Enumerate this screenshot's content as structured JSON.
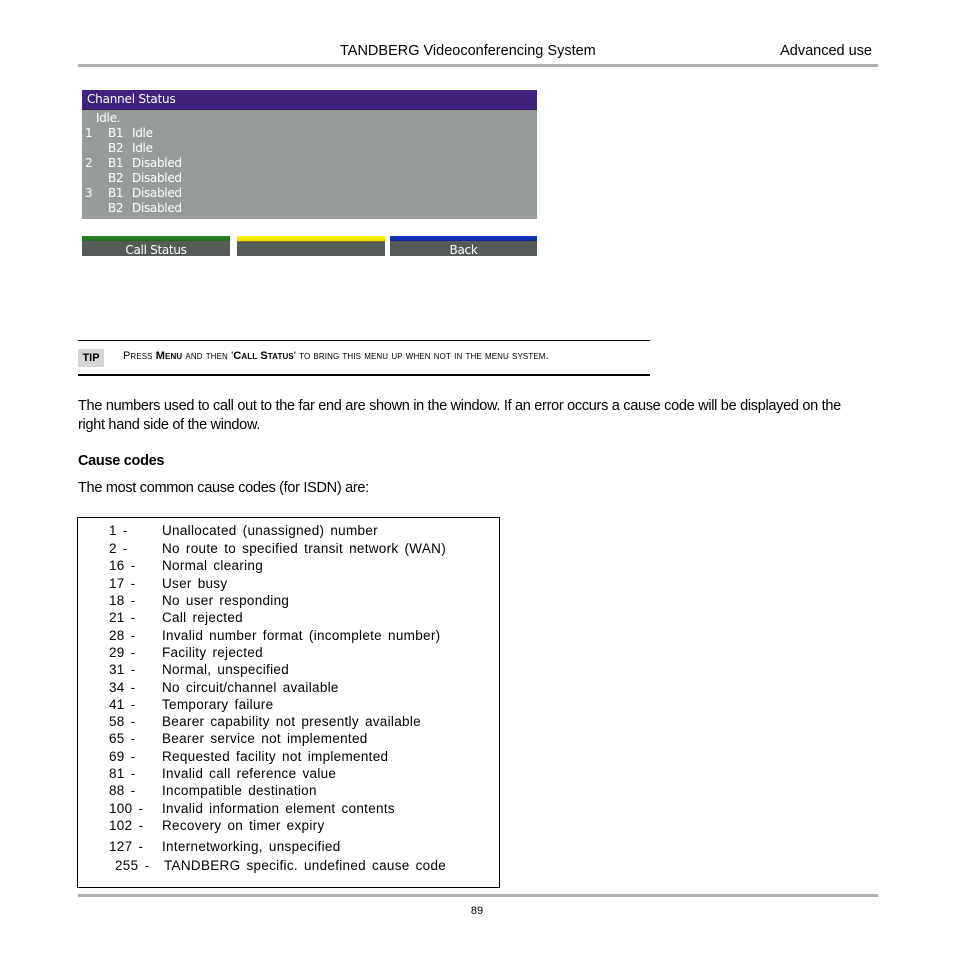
{
  "header": {
    "title": "TANDBERG Videoconferencing System",
    "section": "Advanced use"
  },
  "screen": {
    "title": "Channel Status",
    "status": "Idle.",
    "rows": [
      {
        "port": "1",
        "channel": "B1",
        "state": "Idle"
      },
      {
        "port": "",
        "channel": "B2",
        "state": "Idle"
      },
      {
        "port": "2",
        "channel": "B1",
        "state": "Disabled"
      },
      {
        "port": "",
        "channel": "B2",
        "state": "Disabled"
      },
      {
        "port": "3",
        "channel": "B1",
        "state": "Disabled"
      },
      {
        "port": "",
        "channel": "B2",
        "state": "Disabled"
      }
    ],
    "softkeys": [
      {
        "label": "Call Status",
        "color": "#2a8a2a"
      },
      {
        "label": "",
        "color": "#ffff10"
      },
      {
        "label": "Back",
        "color": "#1b3bd8"
      }
    ],
    "colors": {
      "title_bg": "#40217e",
      "body_bg": "#979c99",
      "button_bg": "#565b58"
    }
  },
  "tip": {
    "badge": "TIP",
    "press": "Press ",
    "menu": "Menu",
    "and_then": " and then '",
    "call_status": "Call Status",
    "rest": "' to bring this menu up when not in the menu system."
  },
  "body": {
    "paragraph": "The numbers used to call out to the far end are shown in the window. If an error occurs a cause code will be displayed on the right hand side of the window.",
    "heading": "Cause codes",
    "intro": "The most common cause codes (for ISDN) are:"
  },
  "cause_codes": [
    {
      "code": "1 -",
      "description": "Unallocated (unassigned) number"
    },
    {
      "code": "2 -",
      "description": "No route to specified transit network (WAN)"
    },
    {
      "code": "16 -",
      "description": "Normal clearing"
    },
    {
      "code": "17 -",
      "description": "User busy"
    },
    {
      "code": "18 -",
      "description": "No user responding"
    },
    {
      "code": "21 -",
      "description": "Call rejected"
    },
    {
      "code": "28 -",
      "description": "Invalid number format (incomplete number)"
    },
    {
      "code": "29 -",
      "description": "Facility rejected"
    },
    {
      "code": "31 -",
      "description": "Normal, unspecified"
    },
    {
      "code": "34 -",
      "description": "No circuit/channel available"
    },
    {
      "code": "41 -",
      "description": "Temporary failure"
    },
    {
      "code": "58 -",
      "description": "Bearer capability not presently available"
    },
    {
      "code": "65 -",
      "description": "Bearer service not implemented"
    },
    {
      "code": "69 -",
      "description": "Requested facility not implemented"
    },
    {
      "code": "81 -",
      "description": "Invalid call reference value"
    },
    {
      "code": "88 -",
      "description": "Incompatible destination"
    },
    {
      "code": "100 -",
      "description": "Invalid information element contents"
    },
    {
      "code": "102 -",
      "description": "Recovery on timer expiry"
    },
    {
      "code": "127 -",
      "description": "Internetworking, unspecified"
    },
    {
      "code": "255 -",
      "description": "TANDBERG specific. undefined cause code"
    }
  ],
  "footer": {
    "page_number": "89"
  }
}
